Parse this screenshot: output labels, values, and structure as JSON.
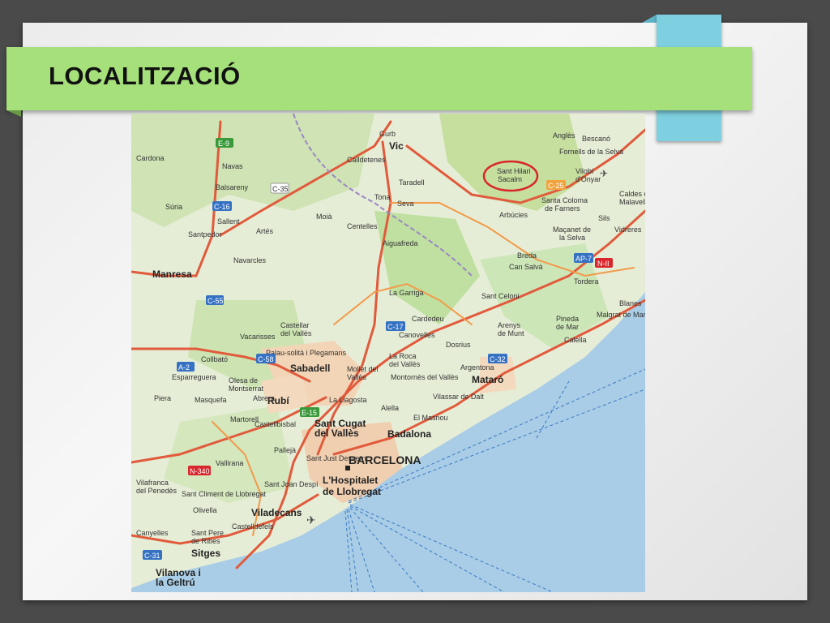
{
  "slide": {
    "title": "LOCALITZACIÓ",
    "accent_color": "#7ecfe0",
    "title_band_color": "#a5e07a"
  },
  "map": {
    "highlight_label": [
      "Sant Hilari",
      "Sacalm"
    ],
    "highlight_color": "#d9262c",
    "sea_color": "#a9cde6",
    "land_color": "#e8efd8",
    "labels": {
      "barcelona": "BARCELONA",
      "hospitalet_1": "L'Hospitalet",
      "hospitalet_2": "de Llobregat",
      "badalona": "Badalona",
      "sabadell": "Sabadell",
      "rubi": "Rubí",
      "santcugat_1": "Sant Cugat",
      "santcugat_2": "del Vallès",
      "mataro": "Mataró",
      "manresa": "Manresa",
      "vic": "Vic",
      "viladecans": "Viladecans",
      "sitges": "Sitges",
      "vilanova_1": "Vilanova i",
      "vilanova_2": "la Geltrú",
      "granollers": "La Garriga",
      "calldetenes": "Calldetenes",
      "taradell": "Taradell",
      "seva": "Seva",
      "tona": "Tona",
      "centelles": "Centelles",
      "aiguafreda": "Aiguafreda",
      "arbucies": "Arbúcies",
      "breda": "Breda",
      "cansalva": "Can Salvà",
      "tordera": "Tordera",
      "malgrat": "Malgrat de Mar",
      "blanes": "Blanes",
      "calella": "Calella",
      "pineda_1": "Pineda",
      "pineda_2": "de Mar",
      "arenys_1": "Arenys",
      "arenys_2": "de Munt",
      "cardedeu": "Cardedeu",
      "canovelles": "Canovelles",
      "dosrius": "Dosrius",
      "argentona": "Argentona",
      "alella": "Alella",
      "elmasnou": "El Masnou",
      "mollet_1": "Mollet del",
      "mollet_2": "Vallès",
      "martorell": "Martorell",
      "collbato": "Collbató",
      "esparreguera": "Esparreguera",
      "olesa_1": "Olesa de",
      "olesa_2": "Montserrat",
      "abrera": "Abrera",
      "masquefa": "Masquefa",
      "piera": "Piera",
      "vacarisses": "Vacarisses",
      "castellbisbal": "Castellbisbal",
      "pallejà": "Pallejà",
      "vallirana": "Vallirana",
      "olivella": "Olivella",
      "castelldefels": "Castelldefels",
      "cardona": "Cardona",
      "navas": "Navas",
      "balsareny": "Balsareny",
      "suria": "Súria",
      "sallent": "Sallent",
      "artes": "Artés",
      "santpedor": "Santpedor",
      "navarcles": "Navarcles",
      "moia": "Moià",
      "gurb": "Gurb",
      "angles": "Anglès",
      "bescano": "Bescanó",
      "fornells": "Fornells de la Selva",
      "vilobi_1": "Vilobí",
      "vilobi_2": "d'Onyar",
      "caldes_1": "Caldes de",
      "caldes_2": "Malavella",
      "sils": "Sils",
      "vidreres": "Vidreres",
      "santacoloma_1": "Santa Coloma",
      "santacoloma_2": "de Farners",
      "macanet_1": "Maçanet de",
      "macanet_2": "la Selva",
      "santceloni": "Sant Celoni",
      "lagarriga": "La Garriga",
      "lameroca_1": "La Roca",
      "lameroca_2": "del Vallès",
      "palau": "Palau-solità i Plegamans",
      "lallagosta": "La Llagosta",
      "montornes": "Montornès del Vallès",
      "vilassar": "Vilassar de Dalt",
      "castellar_1": "Castellar",
      "castellar_2": "del Vallès",
      "santquirze": "Sant Just Desvern",
      "santjoan": "Sant Joan Despí",
      "santclimen": "Sant Climent de Llobregat",
      "santpere_1": "Sant Pere",
      "santpere_2": "de Ribes",
      "canyelles": "Canyelles",
      "vilafranca_1": "Vilafranca",
      "vilafranca_2": "del Penedès"
    },
    "road_labels": {
      "e9": "E-9",
      "c16": "C-16",
      "c25": "C-25",
      "c17": "C-17",
      "c58": "C-58",
      "e15": "E-15",
      "c32": "C-32",
      "c31": "C-31",
      "ap7": "AP-7",
      "n11": "N-II",
      "a2": "A-2",
      "n340": "N-340",
      "c35": "C-35",
      "c55": "C-55"
    }
  }
}
